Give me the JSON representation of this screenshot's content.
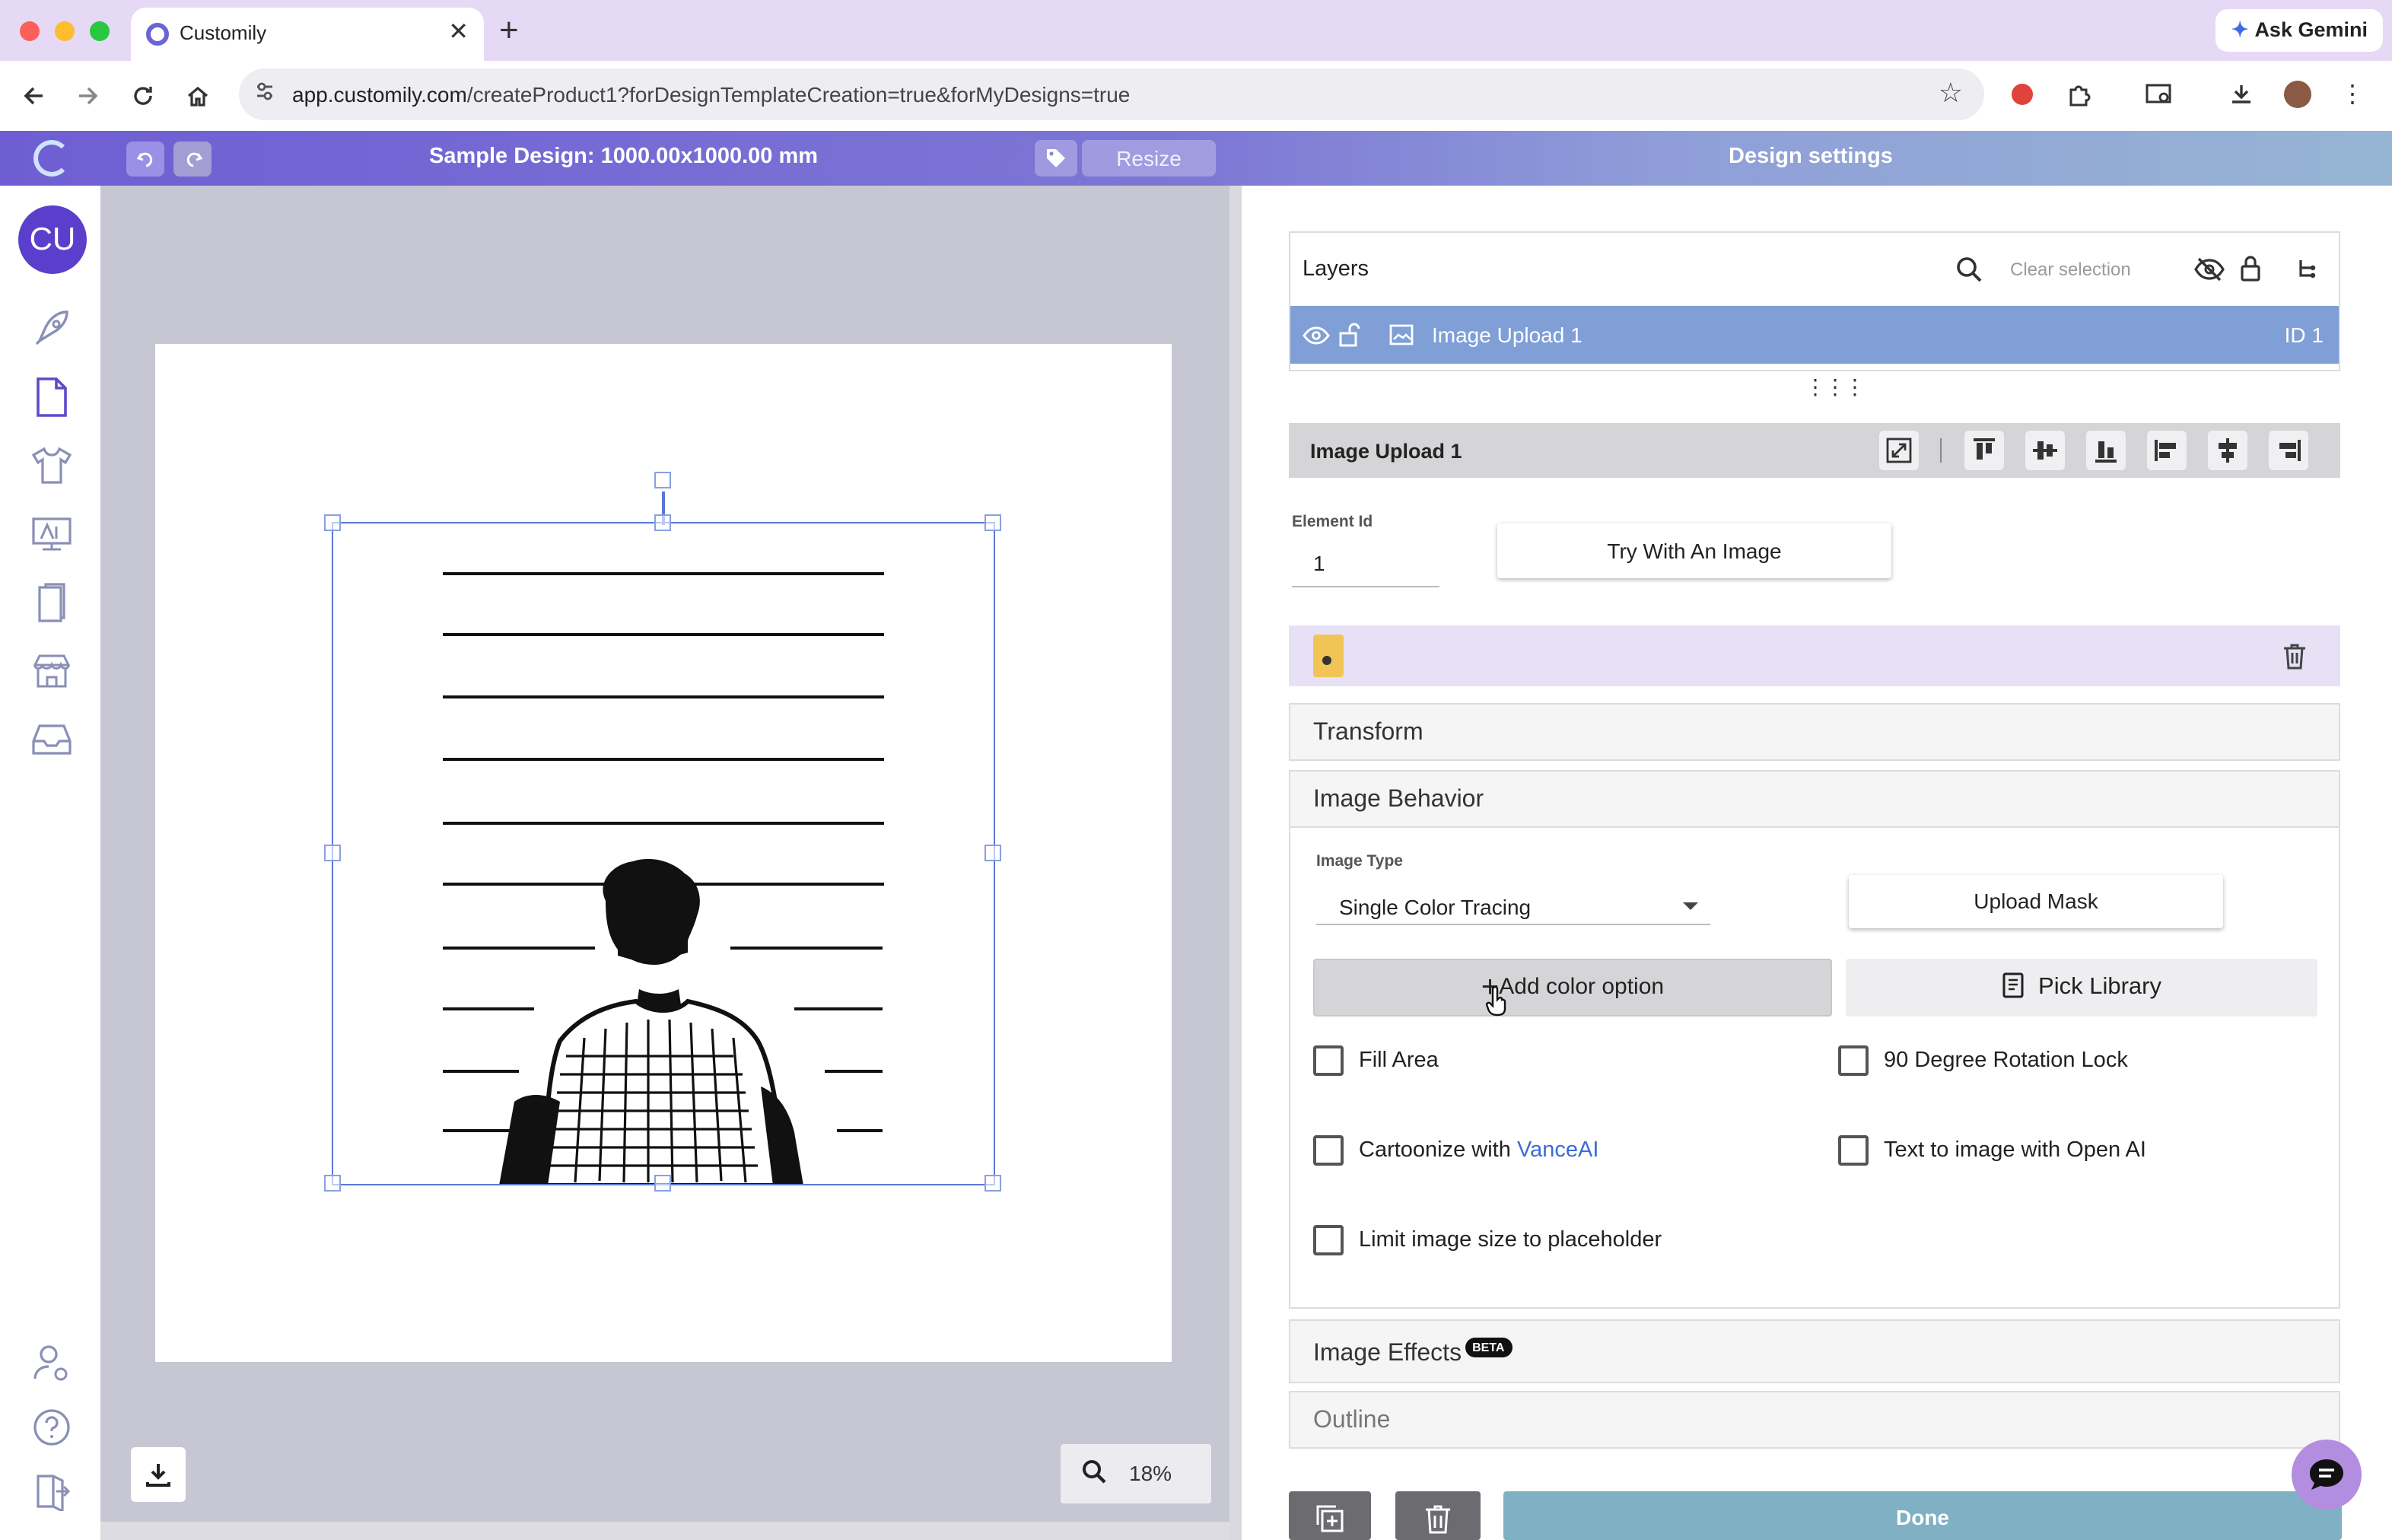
{
  "browser": {
    "tab_title": "Customily",
    "new_tab": "+",
    "tab_close": "✕",
    "gemini_label": "Ask Gemini",
    "url_host": "app.customily.com",
    "url_path": "/createProduct1?forDesignTemplateCreation=true&forMyDesigns=true"
  },
  "header": {
    "design_title": "Sample Design: 1000.00x1000.00 mm",
    "resize_label": "Resize",
    "settings_title": "Design settings"
  },
  "sidebar": {
    "avatar_initials": "CU"
  },
  "canvas": {
    "zoom": "18%"
  },
  "layers": {
    "title": "Layers",
    "clear_selection": "Clear selection",
    "items": [
      {
        "name": "Image Upload 1",
        "id": "ID 1"
      }
    ]
  },
  "element": {
    "title": "Image Upload 1",
    "id_label": "Element Id",
    "id_value": "1",
    "try_button": "Try With An Image"
  },
  "sections": {
    "transform": "Transform",
    "behavior": "Image Behavior",
    "effects": "Image Effects",
    "effects_badge": "BETA",
    "outline": "Outline"
  },
  "behavior": {
    "type_label": "Image Type",
    "type_value": "Single Color Tracing",
    "upload_mask": "Upload Mask",
    "add_color": "Add color option",
    "pick_library": "Pick Library",
    "options": {
      "fill_area": "Fill Area",
      "rotation_lock": "90 Degree Rotation Lock",
      "cartoonize_prefix": "Cartoonize with ",
      "cartoonize_link": "VanceAI",
      "text_to_image": "Text to image with Open AI",
      "limit_size": "Limit image size to placeholder"
    }
  },
  "footer": {
    "done": "Done"
  },
  "colors": {
    "accent": "#6f5ed3",
    "layer_selected": "#7f9fd6",
    "done_button": "#7fb0c4",
    "link": "#3d6bd6"
  }
}
